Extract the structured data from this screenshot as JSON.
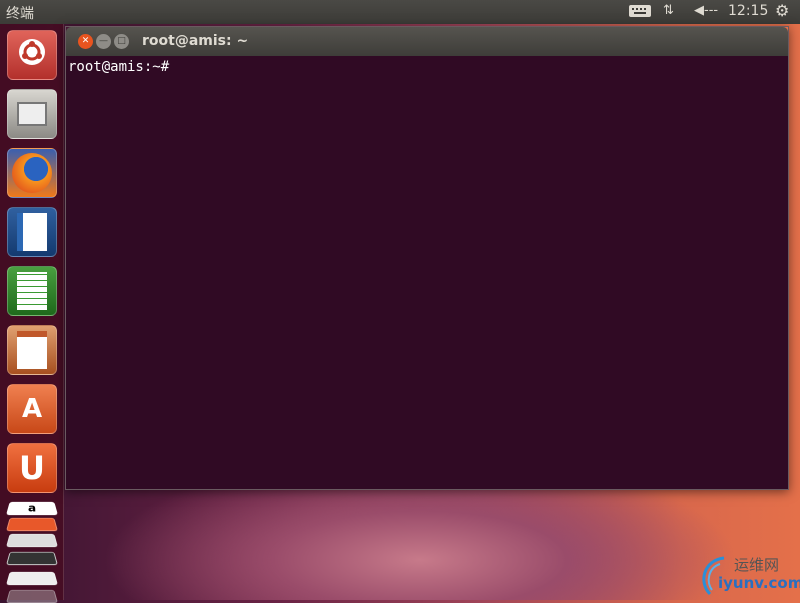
{
  "panel": {
    "app_title": "终端",
    "clock": "12:15",
    "indicators": [
      "keyboard-icon",
      "network-icon",
      "volume-icon",
      "power-gear-icon"
    ]
  },
  "launcher": {
    "items": [
      "Dash Home",
      "Files",
      "Firefox",
      "LibreOffice Writer",
      "LibreOffice Calc",
      "LibreOffice Impress",
      "Ubuntu Software Center",
      "Ubuntu One",
      "Amazon",
      "Ubuntu One Music",
      "Text Editor",
      "Terminal",
      "Workspace Switcher"
    ]
  },
  "window": {
    "title": "root@amis: ~",
    "prompt": "root@amis:~#"
  },
  "watermark": {
    "cn": "运维网",
    "en": "iyunv.com"
  },
  "colors": {
    "terminal_bg": "#300a24",
    "panel_bg": "#3c3b37",
    "close": "#e9541f"
  }
}
